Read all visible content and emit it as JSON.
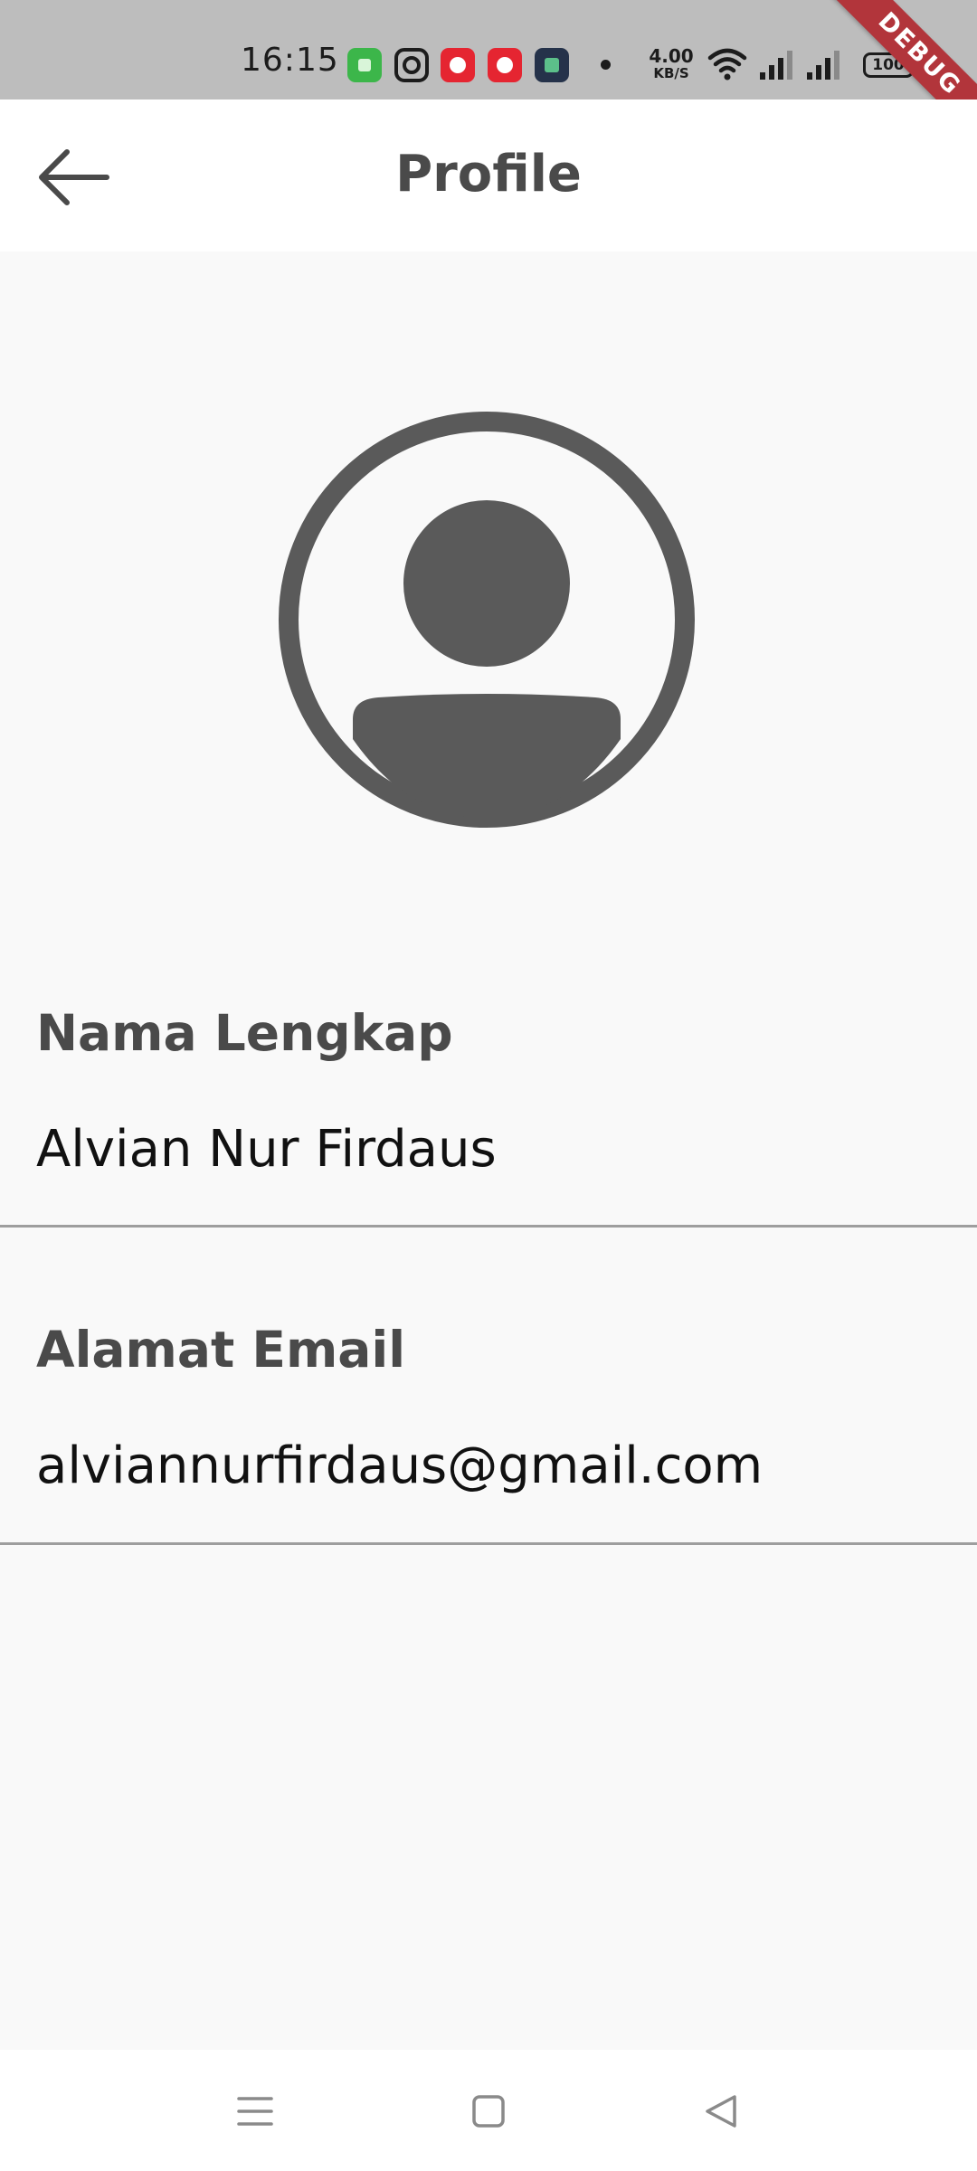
{
  "status_bar": {
    "time": "16:15",
    "net_speed_value": "4.00",
    "net_speed_unit": "KB/S",
    "battery": "100",
    "debug_banner": "DEBUG",
    "icons": [
      "app-green-icon",
      "instagram-icon",
      "app-red-icon",
      "opera-icon",
      "app-dark-icon",
      "notification-dot",
      "wifi-icon",
      "signal-icon",
      "signal-icon",
      "battery-icon"
    ]
  },
  "app_bar": {
    "title": "Profile",
    "back_icon": "arrow-left-icon"
  },
  "profile": {
    "avatar_icon": "account-circle-icon",
    "fields": [
      {
        "label": "Nama Lengkap",
        "value": "Alvian Nur Firdaus"
      },
      {
        "label": "Alamat Email",
        "value": "alviannurfirdaus@gmail.com"
      }
    ]
  },
  "nav_bar": {
    "icons": [
      "menu-icon",
      "home-square-icon",
      "back-triangle-icon"
    ]
  },
  "colors": {
    "status_bar": "#bdbdbd",
    "background": "#f9f9f9",
    "app_bar": "#ffffff",
    "text_primary": "#111111",
    "text_secondary": "#4a4a4a",
    "avatar": "#5a5a5a",
    "divider": "#9e9e9e",
    "debug_ribbon": "#b2353b"
  }
}
